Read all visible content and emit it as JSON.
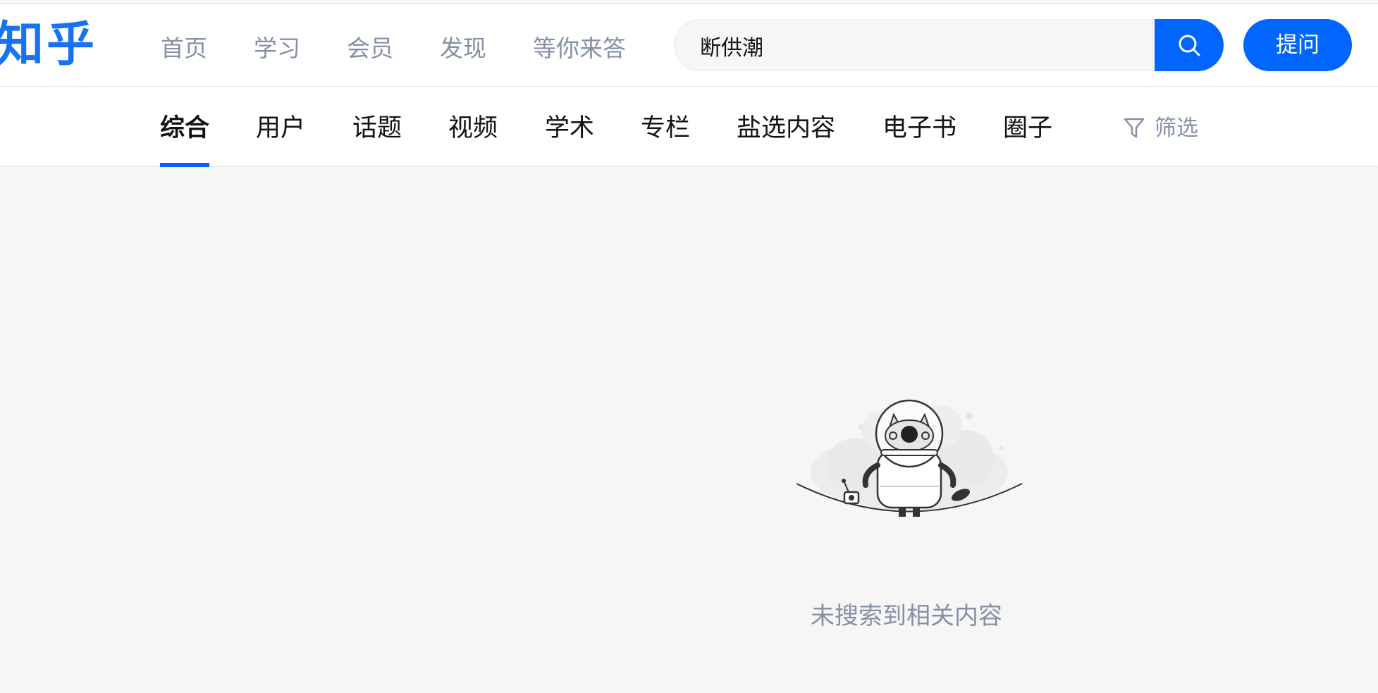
{
  "header": {
    "logo": "知乎",
    "nav": [
      "首页",
      "学习",
      "会员",
      "发现",
      "等你来答"
    ],
    "search": {
      "value": "断供潮"
    },
    "search_icon": "search-icon",
    "ask_label": "提问"
  },
  "tabs": {
    "items": [
      "综合",
      "用户",
      "话题",
      "视频",
      "学术",
      "专栏",
      "盐选内容",
      "电子书",
      "圈子"
    ],
    "active_index": 0,
    "filter_label": "筛选",
    "filter_icon": "filter-icon"
  },
  "empty_state": {
    "illustration": "robot-empty-illustration",
    "message": "未搜索到相关内容"
  },
  "colors": {
    "brand": "#1772f6",
    "accent": "#0066ff",
    "muted_text": "#8590a6",
    "text": "#121212",
    "background": "#f6f6f6"
  }
}
